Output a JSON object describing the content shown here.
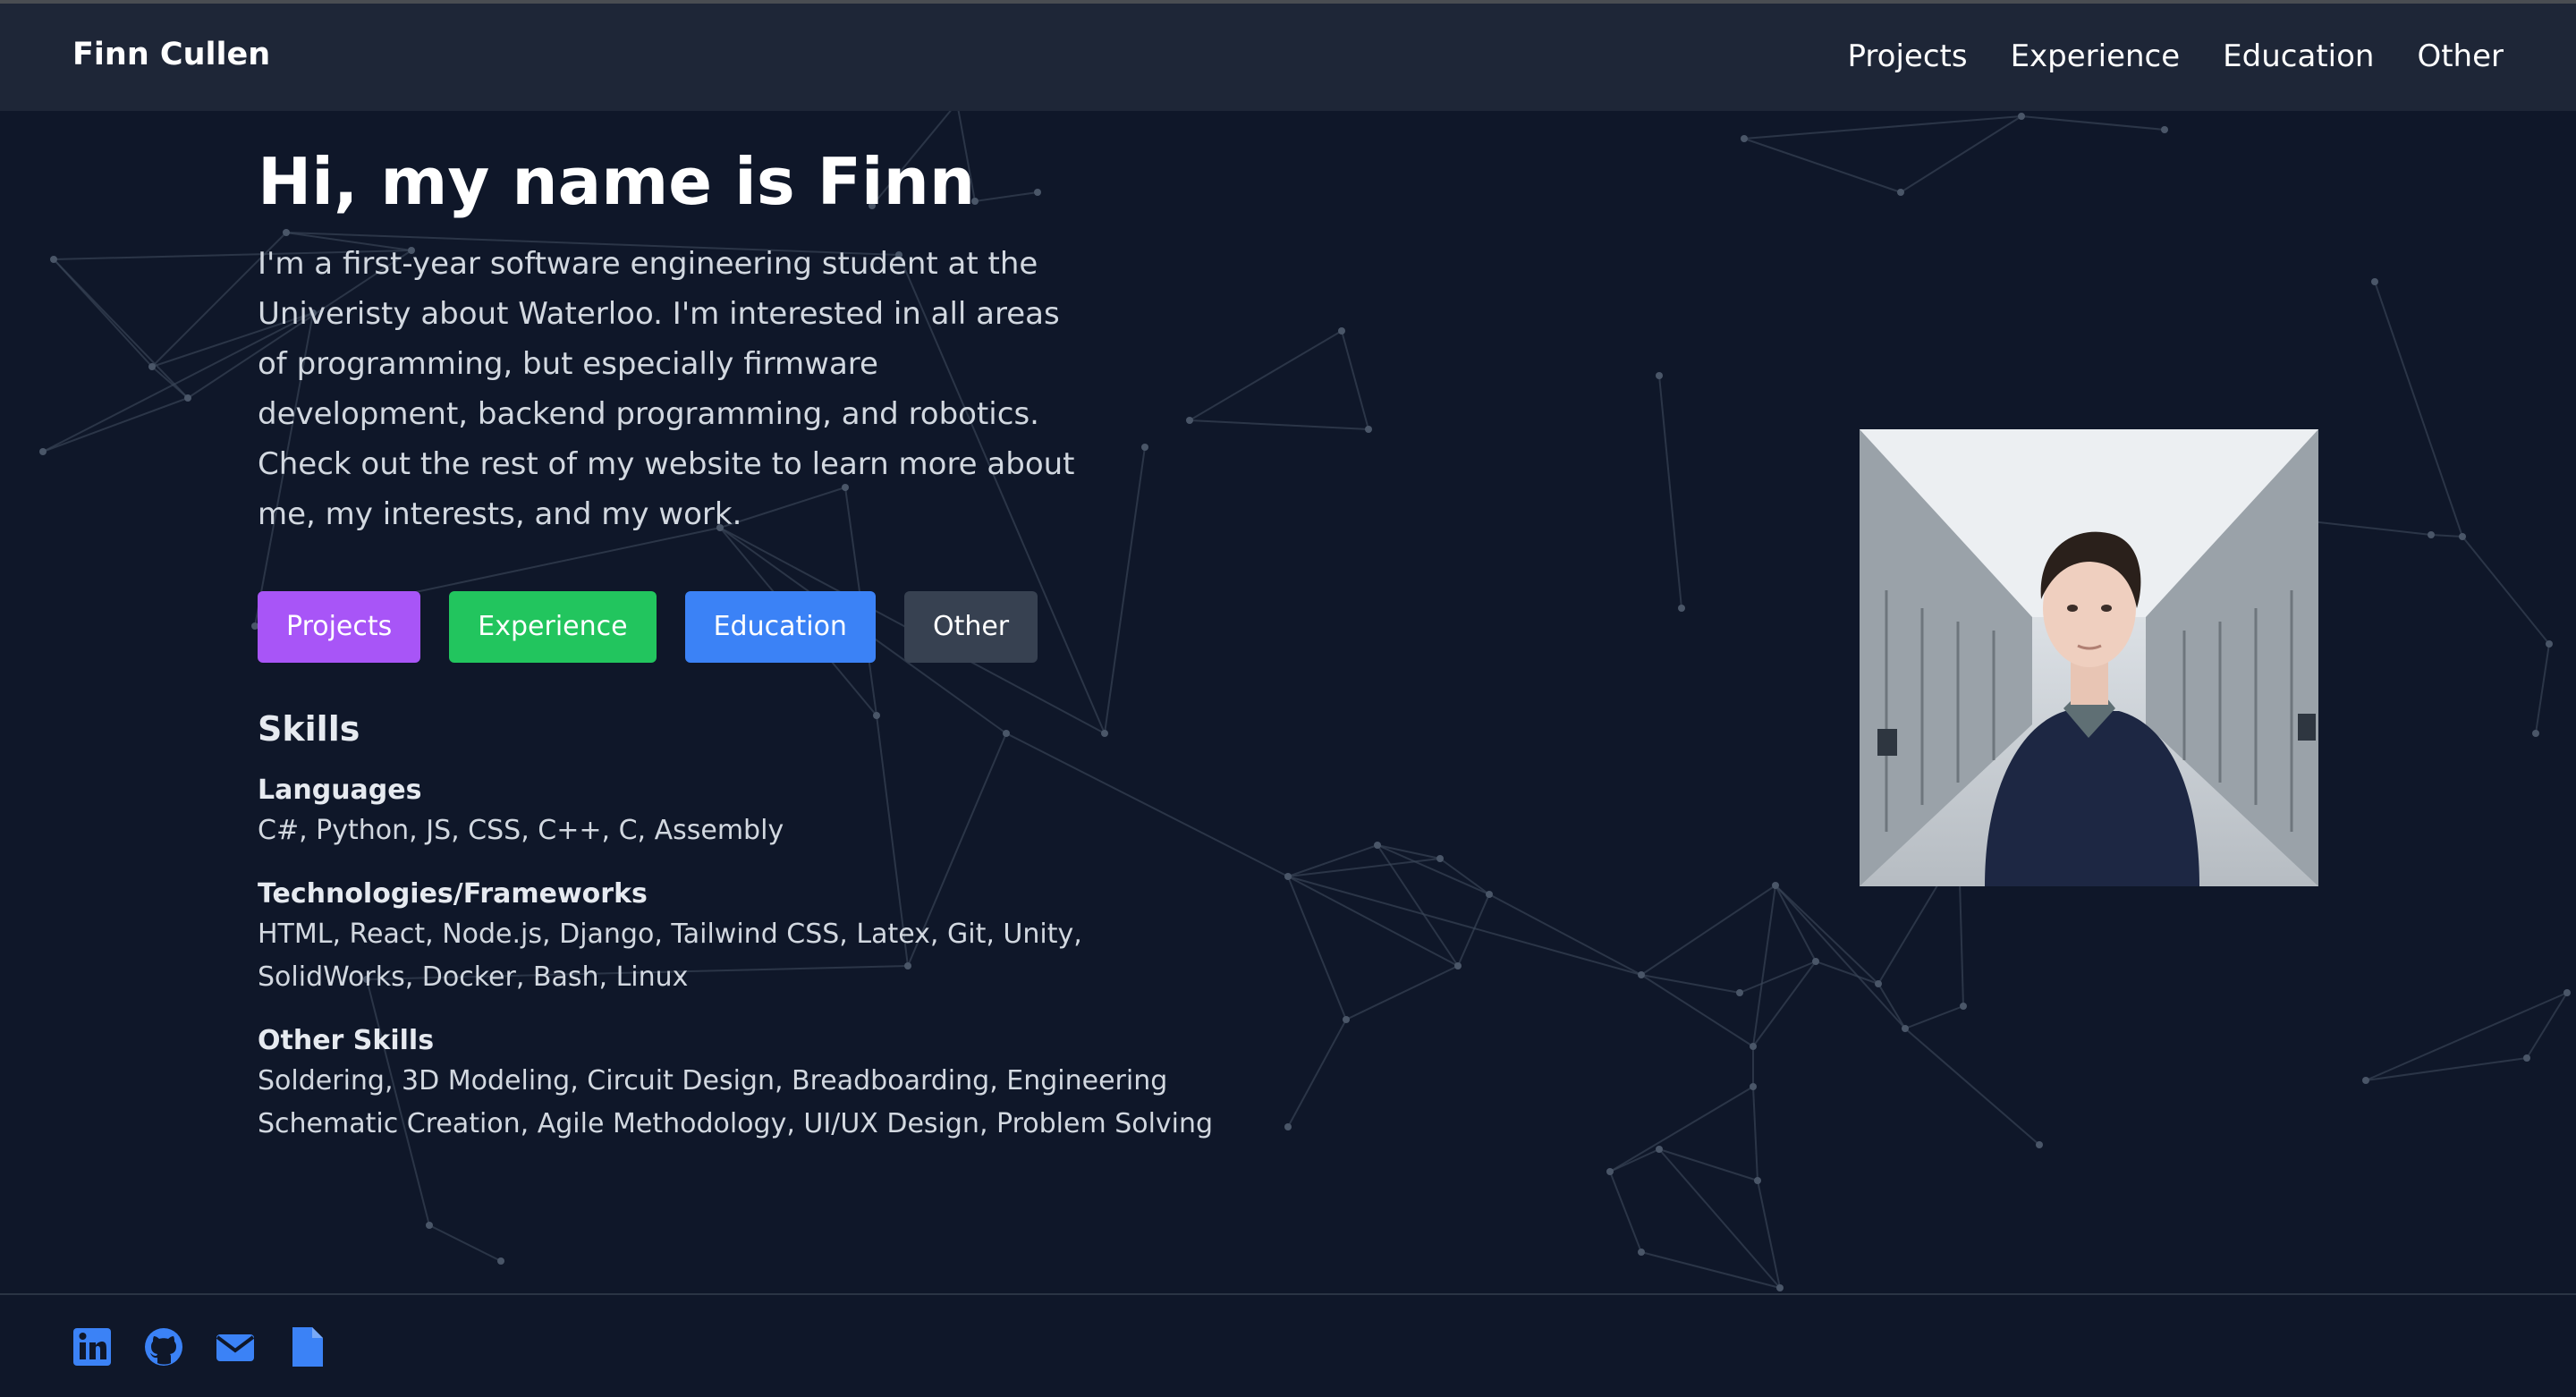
{
  "header": {
    "brand": "Finn Cullen",
    "nav": [
      "Projects",
      "Experience",
      "Education",
      "Other"
    ]
  },
  "hero": {
    "title": "Hi, my name is Finn",
    "intro": "I'm a first-year software engineering student at the Univeristy about Waterloo. I'm interested in all areas of programming, but especially firmware development, backend programming, and robotics. Check out the rest of my website to learn more about me, my interests, and my work.",
    "buttons": [
      {
        "label": "Projects",
        "color": "#a855f7"
      },
      {
        "label": "Experience",
        "color": "#22c55e"
      },
      {
        "label": "Education",
        "color": "#3b82f6"
      },
      {
        "label": "Other",
        "color": "#374151"
      }
    ]
  },
  "skills": {
    "title": "Skills",
    "languages_heading": "Languages",
    "languages": "C#, Python, JS, CSS, C++, C, Assembly",
    "tech_heading": "Technologies/Frameworks",
    "tech": "HTML, React, Node.js, Django, Tailwind CSS, Latex, Git, Unity, SolidWorks, Docker, Bash, Linux",
    "other_heading": "Other Skills",
    "other": "Soldering, 3D Modeling, Circuit Design, Breadboarding, Engineering Schematic Creation, Agile Methodology, UI/UX Design, Problem Solving"
  },
  "portrait": {
    "icon": "profile-photo"
  },
  "footer": {
    "icons": [
      "linkedin-icon",
      "github-icon",
      "email-icon",
      "resume-file-icon"
    ],
    "accent": "#3b82f6"
  },
  "colors": {
    "background": "#0f1729",
    "header": "#1e2637",
    "network_lines": "#3a4658"
  }
}
